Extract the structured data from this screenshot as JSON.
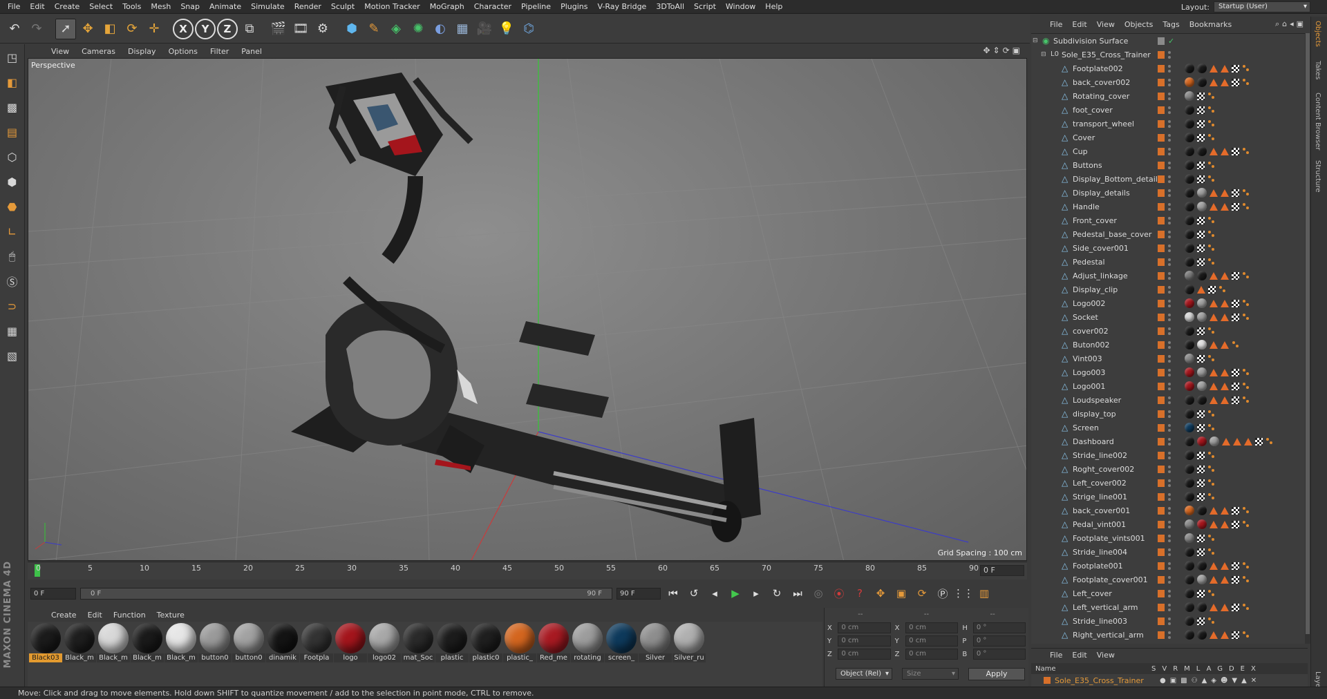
{
  "menubar": {
    "items": [
      "File",
      "Edit",
      "Create",
      "Select",
      "Tools",
      "Mesh",
      "Snap",
      "Animate",
      "Simulate",
      "Render",
      "Sculpt",
      "Motion Tracker",
      "MoGraph",
      "Character",
      "Pipeline",
      "Plugins",
      "V-Ray Bridge",
      "3DToAll",
      "Script",
      "Window",
      "Help"
    ],
    "layout_label": "Layout:",
    "layout_value": "Startup (User)"
  },
  "toolbar": {
    "axes": [
      "X",
      "Y",
      "Z"
    ]
  },
  "viewport": {
    "menu": [
      "View",
      "Cameras",
      "Display",
      "Options",
      "Filter",
      "Panel"
    ],
    "label": "Perspective",
    "grid_spacing": "Grid Spacing : 100 cm",
    "axis_colors": {
      "x": "#c83c3c",
      "y": "#3ccc3c",
      "z": "#3c3cc8"
    }
  },
  "timeline": {
    "ticks": [
      "0",
      "5",
      "10",
      "15",
      "20",
      "25",
      "30",
      "35",
      "40",
      "45",
      "50",
      "55",
      "60",
      "65",
      "70",
      "75",
      "80",
      "85",
      "90"
    ],
    "current_frame_right": "0 F"
  },
  "transport": {
    "start_field": "0 F",
    "slider_left": "0 F",
    "slider_right": "90 F",
    "end_field": "90 F"
  },
  "material_manager": {
    "menu": [
      "Create",
      "Edit",
      "Function",
      "Texture"
    ],
    "materials": [
      {
        "name": "Black03",
        "color": "#1b1b1b",
        "selected": true
      },
      {
        "name": "Black_m",
        "color": "#1e1e1e",
        "selected": false
      },
      {
        "name": "Black_m",
        "color": "#d8d8d8",
        "selected": false
      },
      {
        "name": "Black_m",
        "color": "#1a1a1a",
        "selected": false
      },
      {
        "name": "Black_m",
        "color": "#e6e6e6",
        "selected": false
      },
      {
        "name": "button0",
        "color": "#9a9a9a",
        "selected": false
      },
      {
        "name": "button0",
        "color": "#a2a2a2",
        "selected": false
      },
      {
        "name": "dinamik",
        "color": "#141414",
        "selected": false
      },
      {
        "name": "Footpla",
        "color": "#333333",
        "selected": false
      },
      {
        "name": "logo",
        "color": "#a4151c",
        "selected": false
      },
      {
        "name": "logo02",
        "color": "#a8a8a8",
        "selected": false
      },
      {
        "name": "mat_Soc",
        "color": "#2a2a2a",
        "selected": false
      },
      {
        "name": "plastic",
        "color": "#1c1c1c",
        "selected": false
      },
      {
        "name": "plastic0",
        "color": "#1f1f1f",
        "selected": false
      },
      {
        "name": "plastic_",
        "color": "#d4661f",
        "selected": false
      },
      {
        "name": "Red_me",
        "color": "#a81a22",
        "selected": false
      },
      {
        "name": "rotating",
        "color": "#9d9d9d",
        "selected": false
      },
      {
        "name": "screen_",
        "color": "#0e3a5c",
        "selected": false
      },
      {
        "name": "Silver",
        "color": "#8e8e8e",
        "selected": false
      },
      {
        "name": "Silver_ru",
        "color": "#b0b0b0",
        "selected": false
      }
    ]
  },
  "coordinates": {
    "header": [
      "--",
      "--",
      "--"
    ],
    "rows": [
      {
        "l1": "X",
        "v1": "0 cm",
        "l2": "X",
        "v2": "0 cm",
        "l3": "H",
        "v3": "0 °"
      },
      {
        "l1": "Y",
        "v1": "0 cm",
        "l2": "Y",
        "v2": "0 cm",
        "l3": "P",
        "v3": "0 °"
      },
      {
        "l1": "Z",
        "v1": "0 cm",
        "l2": "Z",
        "v2": "0 cm",
        "l3": "B",
        "v3": "0 °"
      }
    ],
    "mode": "Object (Rel)",
    "size": "Size",
    "apply": "Apply"
  },
  "object_manager": {
    "menu": [
      "File",
      "Edit",
      "View",
      "Objects",
      "Tags",
      "Bookmarks"
    ],
    "objects": [
      {
        "name": "Subdivision Surface",
        "level": 0,
        "tags": []
      },
      {
        "name": "Sole_E35_Cross_Trainer",
        "level": 1,
        "tags": []
      },
      {
        "name": "Footplate002",
        "level": 2,
        "tags": [
          "#1a1a1a",
          "#1a1a1a",
          "tri",
          "tri",
          "chk",
          "dots"
        ]
      },
      {
        "name": "back_cover002",
        "level": 2,
        "tags": [
          "#d4661f",
          "#1a1a1a",
          "tri",
          "tri",
          "chk",
          "dots"
        ]
      },
      {
        "name": "Rotating_cover",
        "level": 2,
        "tags": [
          "#8a8a8a",
          "chk",
          "dots"
        ]
      },
      {
        "name": "foot_cover",
        "level": 2,
        "tags": [
          "#1a1a1a",
          "chk",
          "dots"
        ]
      },
      {
        "name": "transport_wheel",
        "level": 2,
        "tags": [
          "#1a1a1a",
          "chk",
          "dots"
        ]
      },
      {
        "name": "Cover",
        "level": 2,
        "tags": [
          "#1a1a1a",
          "chk",
          "dots"
        ]
      },
      {
        "name": "Cup",
        "level": 2,
        "tags": [
          "#1a1a1a",
          "#1a1a1a",
          "tri",
          "tri",
          "chk",
          "dots"
        ]
      },
      {
        "name": "Buttons",
        "level": 2,
        "tags": [
          "#1a1a1a",
          "chk",
          "dots"
        ]
      },
      {
        "name": "Display_Bottom_details",
        "level": 2,
        "tags": [
          "#1a1a1a",
          "chk",
          "dots"
        ]
      },
      {
        "name": "Display_details",
        "level": 2,
        "tags": [
          "#1a1a1a",
          "#a0a0a0",
          "tri",
          "tri",
          "chk",
          "dots"
        ]
      },
      {
        "name": "Handle",
        "level": 2,
        "tags": [
          "#1a1a1a",
          "#a0a0a0",
          "tri",
          "tri",
          "chk",
          "dots"
        ]
      },
      {
        "name": "Front_cover",
        "level": 2,
        "tags": [
          "#1a1a1a",
          "chk",
          "dots"
        ]
      },
      {
        "name": "Pedestal_base_cover",
        "level": 2,
        "tags": [
          "#1a1a1a",
          "chk",
          "dots"
        ]
      },
      {
        "name": "Side_cover001",
        "level": 2,
        "tags": [
          "#1a1a1a",
          "chk",
          "dots"
        ]
      },
      {
        "name": "Pedestal",
        "level": 2,
        "tags": [
          "#1a1a1a",
          "chk",
          "dots"
        ]
      },
      {
        "name": "Adjust_linkage",
        "level": 2,
        "tags": [
          "#7a7a7a",
          "#1a1a1a",
          "tri",
          "tri",
          "chk",
          "dots"
        ]
      },
      {
        "name": "Display_clip",
        "level": 2,
        "tags": [
          "#1a1a1a",
          "tri",
          "chk",
          "dots"
        ]
      },
      {
        "name": "Logo002",
        "level": 2,
        "tags": [
          "#a4151c",
          "#a0a0a0",
          "tri",
          "tri",
          "chk",
          "dots"
        ]
      },
      {
        "name": "Socket",
        "level": 2,
        "tags": [
          "#d8d8d8",
          "#a0a0a0",
          "tri",
          "tri",
          "chk",
          "dots"
        ]
      },
      {
        "name": "cover002",
        "level": 2,
        "tags": [
          "#1a1a1a",
          "chk",
          "dots"
        ]
      },
      {
        "name": "Buton002",
        "level": 2,
        "tags": [
          "#1a1a1a",
          "#e0e0e0",
          "tri",
          "tri",
          "dots"
        ]
      },
      {
        "name": "Vint003",
        "level": 2,
        "tags": [
          "#8a8a8a",
          "chk",
          "dots"
        ]
      },
      {
        "name": "Logo003",
        "level": 2,
        "tags": [
          "#a4151c",
          "#a0a0a0",
          "tri",
          "tri",
          "chk",
          "dots"
        ]
      },
      {
        "name": "Logo001",
        "level": 2,
        "tags": [
          "#a4151c",
          "#a0a0a0",
          "tri",
          "tri",
          "chk",
          "dots"
        ]
      },
      {
        "name": "Loudspeaker",
        "level": 2,
        "tags": [
          "#1a1a1a",
          "#1a1a1a",
          "tri",
          "tri",
          "chk",
          "dots"
        ]
      },
      {
        "name": "display_top",
        "level": 2,
        "tags": [
          "#1a1a1a",
          "chk",
          "dots"
        ]
      },
      {
        "name": "Screen",
        "level": 2,
        "tags": [
          "#0e3a5c",
          "chk",
          "dots"
        ]
      },
      {
        "name": "Dashboard",
        "level": 2,
        "tags": [
          "#1a1a1a",
          "#a4151c",
          "#a0a0a0",
          "tri",
          "tri",
          "tri",
          "chk",
          "dots"
        ]
      },
      {
        "name": "Stride_line002",
        "level": 2,
        "tags": [
          "#1a1a1a",
          "chk",
          "dots"
        ]
      },
      {
        "name": "Roght_cover002",
        "level": 2,
        "tags": [
          "#1a1a1a",
          "chk",
          "dots"
        ]
      },
      {
        "name": "Left_cover002",
        "level": 2,
        "tags": [
          "#1a1a1a",
          "chk",
          "dots"
        ]
      },
      {
        "name": "Strige_line001",
        "level": 2,
        "tags": [
          "#1a1a1a",
          "chk",
          "dots"
        ]
      },
      {
        "name": "back_cover001",
        "level": 2,
        "tags": [
          "#d4661f",
          "#1a1a1a",
          "tri",
          "tri",
          "chk",
          "dots"
        ]
      },
      {
        "name": "Pedal_vint001",
        "level": 2,
        "tags": [
          "#8a8a8a",
          "#a4151c",
          "tri",
          "tri",
          "chk",
          "dots"
        ]
      },
      {
        "name": "Footplate_vints001",
        "level": 2,
        "tags": [
          "#8a8a8a",
          "chk",
          "dots"
        ]
      },
      {
        "name": "Stride_line004",
        "level": 2,
        "tags": [
          "#1a1a1a",
          "chk",
          "dots"
        ]
      },
      {
        "name": "Footplate001",
        "level": 2,
        "tags": [
          "#1a1a1a",
          "#1a1a1a",
          "tri",
          "tri",
          "chk",
          "dots"
        ]
      },
      {
        "name": "Footplate_cover001",
        "level": 2,
        "tags": [
          "#1a1a1a",
          "#a0a0a0",
          "tri",
          "tri",
          "chk",
          "dots"
        ]
      },
      {
        "name": "Left_cover",
        "level": 2,
        "tags": [
          "#1a1a1a",
          "chk",
          "dots"
        ]
      },
      {
        "name": "Left_vertical_arm",
        "level": 2,
        "tags": [
          "#1a1a1a",
          "#1a1a1a",
          "tri",
          "tri",
          "chk",
          "dots"
        ]
      },
      {
        "name": "Stride_line003",
        "level": 2,
        "tags": [
          "#1a1a1a",
          "chk",
          "dots"
        ]
      },
      {
        "name": "Right_vertical_arm",
        "level": 2,
        "tags": [
          "#1a1a1a",
          "#1a1a1a",
          "tri",
          "tri",
          "chk",
          "dots"
        ]
      }
    ]
  },
  "layer_manager": {
    "menu": [
      "File",
      "Edit",
      "View"
    ],
    "header_name": "Name",
    "header_cols": "SVRMLAGDEX",
    "layer_name": "Sole_E35_Cross_Trainer"
  },
  "right_tabs": [
    "Objects",
    "Takes",
    "Content Browser",
    "Structure",
    "Layers"
  ],
  "status_bar": "Move: Click and drag to move elements. Hold down SHIFT to quantize movement / add to the selection in point mode, CTRL to remove."
}
